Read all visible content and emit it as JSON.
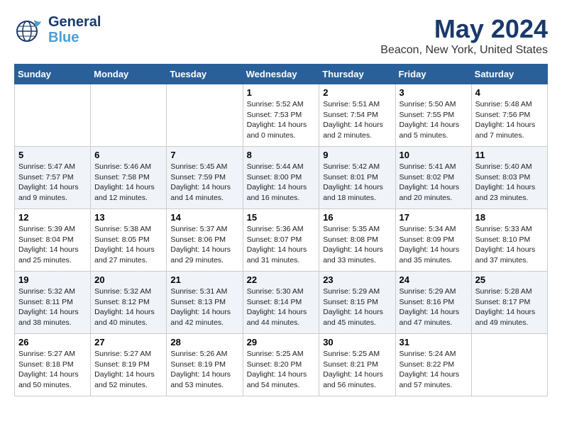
{
  "header": {
    "logo_general": "General",
    "logo_blue": "Blue",
    "month_title": "May 2024",
    "location": "Beacon, New York, United States"
  },
  "days_of_week": [
    "Sunday",
    "Monday",
    "Tuesday",
    "Wednesday",
    "Thursday",
    "Friday",
    "Saturday"
  ],
  "weeks": [
    [
      {
        "day": "",
        "info": ""
      },
      {
        "day": "",
        "info": ""
      },
      {
        "day": "",
        "info": ""
      },
      {
        "day": "1",
        "info": "Sunrise: 5:52 AM\nSunset: 7:53 PM\nDaylight: 14 hours\nand 0 minutes."
      },
      {
        "day": "2",
        "info": "Sunrise: 5:51 AM\nSunset: 7:54 PM\nDaylight: 14 hours\nand 2 minutes."
      },
      {
        "day": "3",
        "info": "Sunrise: 5:50 AM\nSunset: 7:55 PM\nDaylight: 14 hours\nand 5 minutes."
      },
      {
        "day": "4",
        "info": "Sunrise: 5:48 AM\nSunset: 7:56 PM\nDaylight: 14 hours\nand 7 minutes."
      }
    ],
    [
      {
        "day": "5",
        "info": "Sunrise: 5:47 AM\nSunset: 7:57 PM\nDaylight: 14 hours\nand 9 minutes."
      },
      {
        "day": "6",
        "info": "Sunrise: 5:46 AM\nSunset: 7:58 PM\nDaylight: 14 hours\nand 12 minutes."
      },
      {
        "day": "7",
        "info": "Sunrise: 5:45 AM\nSunset: 7:59 PM\nDaylight: 14 hours\nand 14 minutes."
      },
      {
        "day": "8",
        "info": "Sunrise: 5:44 AM\nSunset: 8:00 PM\nDaylight: 14 hours\nand 16 minutes."
      },
      {
        "day": "9",
        "info": "Sunrise: 5:42 AM\nSunset: 8:01 PM\nDaylight: 14 hours\nand 18 minutes."
      },
      {
        "day": "10",
        "info": "Sunrise: 5:41 AM\nSunset: 8:02 PM\nDaylight: 14 hours\nand 20 minutes."
      },
      {
        "day": "11",
        "info": "Sunrise: 5:40 AM\nSunset: 8:03 PM\nDaylight: 14 hours\nand 23 minutes."
      }
    ],
    [
      {
        "day": "12",
        "info": "Sunrise: 5:39 AM\nSunset: 8:04 PM\nDaylight: 14 hours\nand 25 minutes."
      },
      {
        "day": "13",
        "info": "Sunrise: 5:38 AM\nSunset: 8:05 PM\nDaylight: 14 hours\nand 27 minutes."
      },
      {
        "day": "14",
        "info": "Sunrise: 5:37 AM\nSunset: 8:06 PM\nDaylight: 14 hours\nand 29 minutes."
      },
      {
        "day": "15",
        "info": "Sunrise: 5:36 AM\nSunset: 8:07 PM\nDaylight: 14 hours\nand 31 minutes."
      },
      {
        "day": "16",
        "info": "Sunrise: 5:35 AM\nSunset: 8:08 PM\nDaylight: 14 hours\nand 33 minutes."
      },
      {
        "day": "17",
        "info": "Sunrise: 5:34 AM\nSunset: 8:09 PM\nDaylight: 14 hours\nand 35 minutes."
      },
      {
        "day": "18",
        "info": "Sunrise: 5:33 AM\nSunset: 8:10 PM\nDaylight: 14 hours\nand 37 minutes."
      }
    ],
    [
      {
        "day": "19",
        "info": "Sunrise: 5:32 AM\nSunset: 8:11 PM\nDaylight: 14 hours\nand 38 minutes."
      },
      {
        "day": "20",
        "info": "Sunrise: 5:32 AM\nSunset: 8:12 PM\nDaylight: 14 hours\nand 40 minutes."
      },
      {
        "day": "21",
        "info": "Sunrise: 5:31 AM\nSunset: 8:13 PM\nDaylight: 14 hours\nand 42 minutes."
      },
      {
        "day": "22",
        "info": "Sunrise: 5:30 AM\nSunset: 8:14 PM\nDaylight: 14 hours\nand 44 minutes."
      },
      {
        "day": "23",
        "info": "Sunrise: 5:29 AM\nSunset: 8:15 PM\nDaylight: 14 hours\nand 45 minutes."
      },
      {
        "day": "24",
        "info": "Sunrise: 5:29 AM\nSunset: 8:16 PM\nDaylight: 14 hours\nand 47 minutes."
      },
      {
        "day": "25",
        "info": "Sunrise: 5:28 AM\nSunset: 8:17 PM\nDaylight: 14 hours\nand 49 minutes."
      }
    ],
    [
      {
        "day": "26",
        "info": "Sunrise: 5:27 AM\nSunset: 8:18 PM\nDaylight: 14 hours\nand 50 minutes."
      },
      {
        "day": "27",
        "info": "Sunrise: 5:27 AM\nSunset: 8:19 PM\nDaylight: 14 hours\nand 52 minutes."
      },
      {
        "day": "28",
        "info": "Sunrise: 5:26 AM\nSunset: 8:19 PM\nDaylight: 14 hours\nand 53 minutes."
      },
      {
        "day": "29",
        "info": "Sunrise: 5:25 AM\nSunset: 8:20 PM\nDaylight: 14 hours\nand 54 minutes."
      },
      {
        "day": "30",
        "info": "Sunrise: 5:25 AM\nSunset: 8:21 PM\nDaylight: 14 hours\nand 56 minutes."
      },
      {
        "day": "31",
        "info": "Sunrise: 5:24 AM\nSunset: 8:22 PM\nDaylight: 14 hours\nand 57 minutes."
      },
      {
        "day": "",
        "info": ""
      }
    ]
  ]
}
